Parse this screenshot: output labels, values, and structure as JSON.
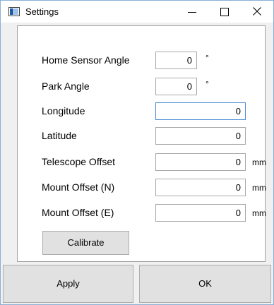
{
  "window": {
    "title": "Settings"
  },
  "form": {
    "rows": [
      {
        "label": "Home Sensor Angle",
        "value": "0",
        "unit": "°"
      },
      {
        "label": "Park Angle",
        "value": "0",
        "unit": "°"
      },
      {
        "label": "Longitude",
        "value": "0",
        "unit": ""
      },
      {
        "label": "Latitude",
        "value": "0",
        "unit": ""
      },
      {
        "label": "Telescope Offset",
        "value": "0",
        "unit": "mm"
      },
      {
        "label": "Mount Offset (N)",
        "value": "0",
        "unit": "mm"
      },
      {
        "label": "Mount Offset (E)",
        "value": "0",
        "unit": "mm"
      }
    ],
    "calibrate_label": "Calibrate"
  },
  "footer": {
    "apply_label": "Apply",
    "ok_label": "OK"
  }
}
